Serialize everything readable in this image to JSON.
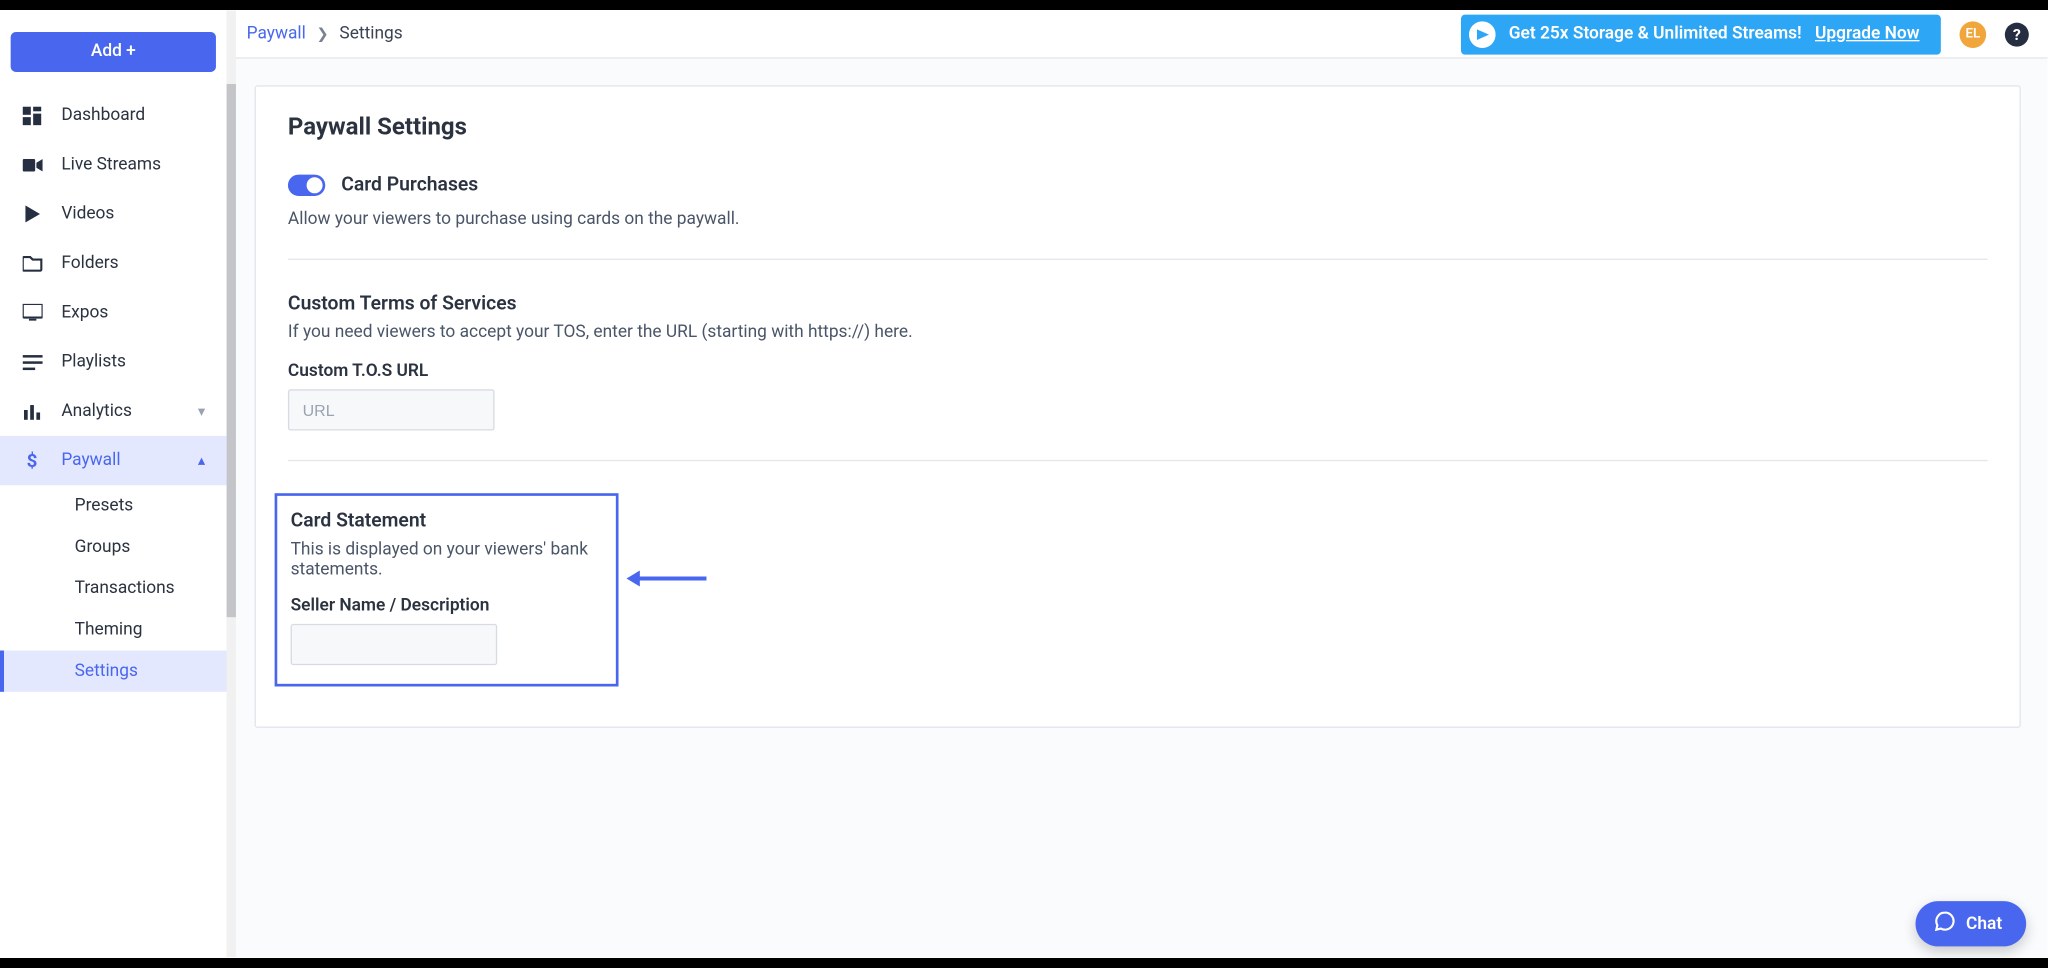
{
  "sidebar": {
    "add_button": "Add +",
    "items": [
      {
        "icon": "dashboard",
        "label": "Dashboard"
      },
      {
        "icon": "camera",
        "label": "Live Streams"
      },
      {
        "icon": "play",
        "label": "Videos"
      },
      {
        "icon": "folder",
        "label": "Folders"
      },
      {
        "icon": "monitor",
        "label": "Expos"
      },
      {
        "icon": "playlist",
        "label": "Playlists"
      },
      {
        "icon": "chart",
        "label": "Analytics",
        "chevron": "down"
      },
      {
        "icon": "dollar",
        "label": "Paywall",
        "chevron": "up",
        "active": true
      }
    ],
    "paywall_sub": [
      {
        "label": "Presets"
      },
      {
        "label": "Groups"
      },
      {
        "label": "Transactions"
      },
      {
        "label": "Theming"
      },
      {
        "label": "Settings",
        "active": true
      }
    ]
  },
  "breadcrumb": {
    "parent": "Paywall",
    "current": "Settings"
  },
  "banner": {
    "text": "Get 25x Storage & Unlimited Streams! ",
    "cta": "Upgrade Now"
  },
  "avatar": "EL",
  "page": {
    "title": "Paywall Settings",
    "card_purchases": {
      "label": "Card Purchases",
      "desc": "Allow your viewers to purchase using cards on the paywall.",
      "enabled": true
    },
    "tos": {
      "heading": "Custom Terms of Services",
      "desc": "If you need viewers to accept your TOS, enter the URL (starting with https://) here.",
      "field_label": "Custom T.O.S URL",
      "placeholder": "URL",
      "value": ""
    },
    "statement": {
      "heading": "Card Statement",
      "desc": "This is displayed on your viewers' bank statements.",
      "field_label": "Seller Name / Description",
      "value": ""
    }
  },
  "chat": {
    "label": "Chat"
  }
}
